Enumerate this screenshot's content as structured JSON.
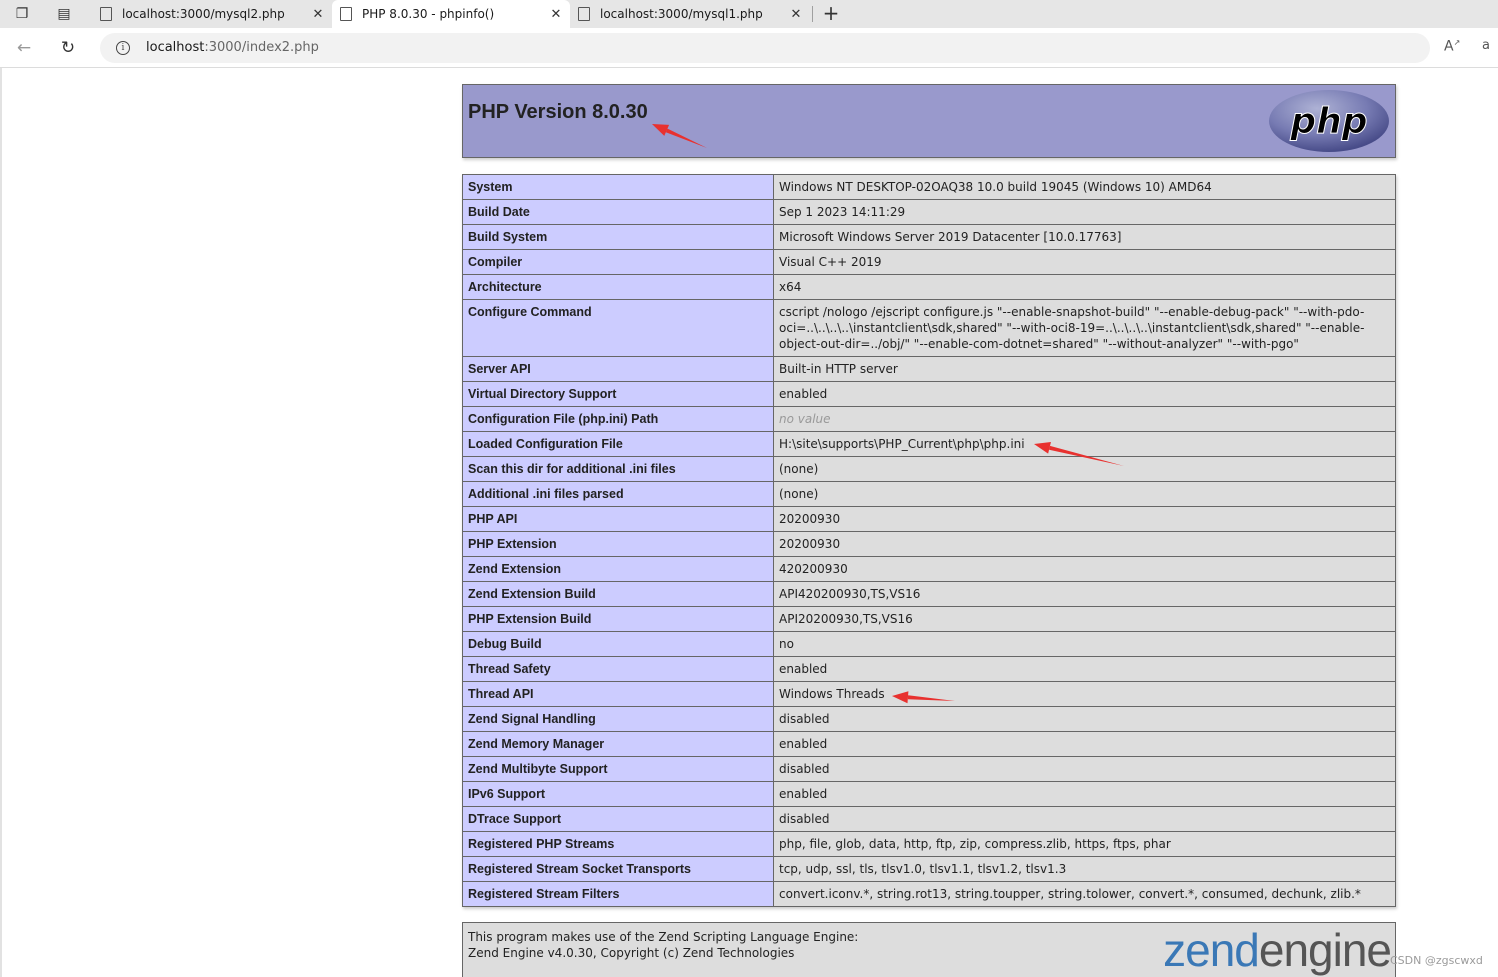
{
  "browser": {
    "tabs": [
      {
        "label": "localhost:3000/mysql2.php",
        "active": false
      },
      {
        "label": "PHP 8.0.30 - phpinfo()",
        "active": true
      },
      {
        "label": "localhost:3000/mysql1.php",
        "active": false
      }
    ],
    "url_host": "localhost",
    "url_path": ":3000/index2.php",
    "read_aloud_glyph": "A",
    "translate_glyph": "a"
  },
  "header": {
    "title": "PHP Version 8.0.30",
    "logo_text": "php"
  },
  "info_rows": [
    {
      "key": "System",
      "value": "Windows NT DESKTOP-02OAQ38 10.0 build 19045 (Windows 10) AMD64"
    },
    {
      "key": "Build Date",
      "value": "Sep 1 2023 14:11:29"
    },
    {
      "key": "Build System",
      "value": "Microsoft Windows Server 2019 Datacenter [10.0.17763]"
    },
    {
      "key": "Compiler",
      "value": "Visual C++ 2019"
    },
    {
      "key": "Architecture",
      "value": "x64"
    },
    {
      "key": "Configure Command",
      "value": "cscript /nologo /ejscript configure.js \"--enable-snapshot-build\" \"--enable-debug-pack\" \"--with-pdo-oci=..\\..\\..\\..\\instantclient\\sdk,shared\" \"--with-oci8-19=..\\..\\..\\..\\instantclient\\sdk,shared\" \"--enable-object-out-dir=../obj/\" \"--enable-com-dotnet=shared\" \"--without-analyzer\" \"--with-pgo\""
    },
    {
      "key": "Server API",
      "value": "Built-in HTTP server"
    },
    {
      "key": "Virtual Directory Support",
      "value": "enabled"
    },
    {
      "key": "Configuration File (php.ini) Path",
      "value": "no value"
    },
    {
      "key": "Loaded Configuration File",
      "value": "H:\\site\\supports\\PHP_Current\\php\\php.ini"
    },
    {
      "key": "Scan this dir for additional .ini files",
      "value": "(none)"
    },
    {
      "key": "Additional .ini files parsed",
      "value": "(none)"
    },
    {
      "key": "PHP API",
      "value": "20200930"
    },
    {
      "key": "PHP Extension",
      "value": "20200930"
    },
    {
      "key": "Zend Extension",
      "value": "420200930"
    },
    {
      "key": "Zend Extension Build",
      "value": "API420200930,TS,VS16"
    },
    {
      "key": "PHP Extension Build",
      "value": "API20200930,TS,VS16"
    },
    {
      "key": "Debug Build",
      "value": "no"
    },
    {
      "key": "Thread Safety",
      "value": "enabled"
    },
    {
      "key": "Thread API",
      "value": "Windows Threads"
    },
    {
      "key": "Zend Signal Handling",
      "value": "disabled"
    },
    {
      "key": "Zend Memory Manager",
      "value": "enabled"
    },
    {
      "key": "Zend Multibyte Support",
      "value": "disabled"
    },
    {
      "key": "IPv6 Support",
      "value": "enabled"
    },
    {
      "key": "DTrace Support",
      "value": "disabled"
    },
    {
      "key": "Registered PHP Streams",
      "value": "php, file, glob, data, http, ftp, zip, compress.zlib, https, ftps, phar"
    },
    {
      "key": "Registered Stream Socket Transports",
      "value": "tcp, udp, ssl, tls, tlsv1.0, tlsv1.1, tlsv1.2, tlsv1.3"
    },
    {
      "key": "Registered Stream Filters",
      "value": "convert.iconv.*, string.rot13, string.toupper, string.tolower, convert.*, consumed, dechunk, zlib.*"
    }
  ],
  "footer": {
    "line1": "This program makes use of the Zend Scripting Language Engine:",
    "line2": "Zend Engine v4.0.30, Copyright (c) Zend Technologies",
    "logo_zend": "zend",
    "logo_engine": "engine"
  },
  "annotation_color": "#e8312f",
  "watermark": "CSDN @zgscwxd"
}
